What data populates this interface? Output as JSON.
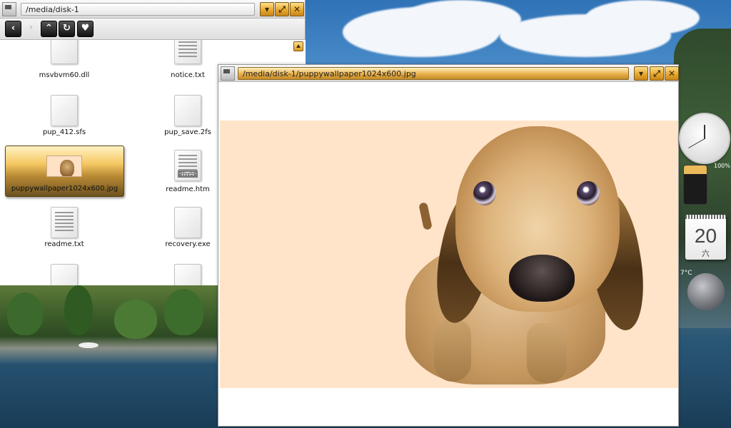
{
  "colors": {
    "accent_gold": "#e6a830",
    "canvas_bg": "#ffe4c9"
  },
  "file_manager": {
    "path": "/media/disk-1",
    "titlebar_buttons": [
      "dropdown-icon",
      "maximize-icon",
      "close-icon"
    ],
    "toolbar_buttons": [
      "back-icon",
      "forward-icon",
      "up-icon",
      "refresh-icon",
      "bookmark-heart-icon"
    ],
    "files": [
      {
        "name": "msvbvm60.dll",
        "icon": "file-icon"
      },
      {
        "name": "notice.txt",
        "icon": "text-file-icon"
      },
      {
        "name": "pup_412.sfs",
        "icon": "file-icon"
      },
      {
        "name": "pup_save.2fs",
        "icon": "file-icon"
      },
      {
        "name": "puppywallpaper1024x600.jpg",
        "icon": "image-thumbnail",
        "selected": true
      },
      {
        "name": "readme.htm",
        "icon": "html-file-icon",
        "badge": "HTM"
      },
      {
        "name": "readme.txt",
        "icon": "text-file-icon"
      },
      {
        "name": "recovery.exe",
        "icon": "file-icon"
      }
    ]
  },
  "viewer": {
    "path": "/media/disk-1/puppywallpaper1024x600.jpg",
    "titlebar_buttons": [
      "dropdown-icon",
      "maximize-icon",
      "close-icon"
    ]
  },
  "widgets": {
    "battery_percent": "100%",
    "calendar_day": "20",
    "calendar_weekday": "六",
    "temperature": "7°C"
  }
}
